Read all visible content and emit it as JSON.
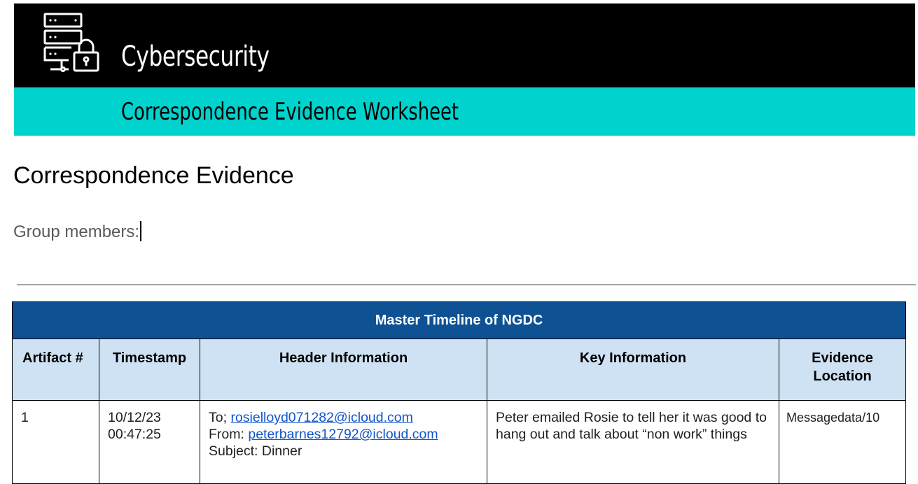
{
  "banner": {
    "title": "Cybersecurity",
    "icon": "server-lock-icon"
  },
  "subbanner": {
    "title": "Correspondence Evidence Worksheet"
  },
  "document": {
    "heading": "Correspondence Evidence",
    "group_members_label": "Group members:"
  },
  "table": {
    "title": "Master Timeline of NGDC",
    "columns": [
      "Artifact #",
      "Timestamp",
      "Header Information",
      "Key Information",
      "Evidence Location"
    ],
    "rows": [
      {
        "artifact": "1",
        "timestamp_date": "10/12/23",
        "timestamp_time": "00:47:25",
        "to_label": "To; ",
        "to_email": "rosielloyd071282@icloud.com",
        "from_label": "From: ",
        "from_email": "peterbarnes12792@icloud.com",
        "subject": "Subject: Dinner",
        "key_info": "Peter emailed Rosie to tell her it was good to hang out and talk about “non work” things",
        "location": "Messagedata/10"
      }
    ]
  },
  "colors": {
    "banner_bg": "#000000",
    "subbanner_bg": "#00d3cd",
    "table_title_bg": "#0f5294",
    "table_header_bg": "#cfe2f3",
    "link": "#1155cc"
  }
}
